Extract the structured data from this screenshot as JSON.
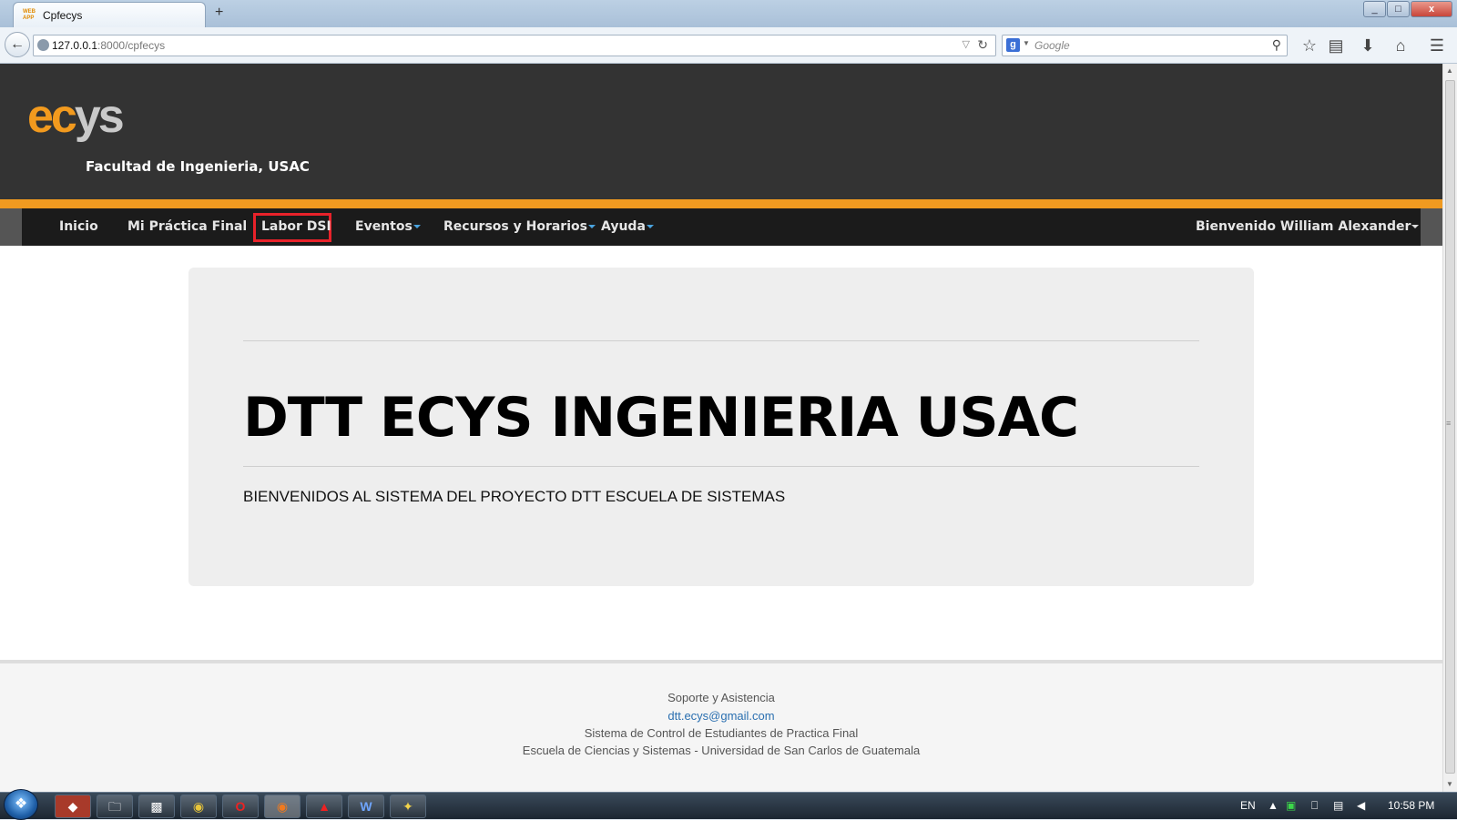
{
  "browser": {
    "tab_title": "Cpfecys",
    "favicon_text": "WEB APP",
    "new_tab": "+",
    "url_host": "127.0.0.1",
    "url_path": ":8000/cpfecys",
    "search_placeholder": "Google",
    "window_controls": {
      "minimize": "_",
      "maximize": "□",
      "close": "x"
    }
  },
  "site": {
    "logo_part1": "ec",
    "logo_part2": "ys",
    "faculty": "Facultad de Ingenieria, USAC",
    "menu": {
      "inicio": "Inicio",
      "practica": "Mi Práctica Final",
      "labor": "Labor DSI",
      "eventos": "Eventos",
      "recursos": "Recursos y Horarios",
      "ayuda": "Ayuda",
      "user": "Bienvenido William Alexander"
    },
    "hero": {
      "title": "DTT ECYS INGENIERIA USAC",
      "subtitle": "BIENVENIDOS AL SISTEMA DEL PROYECTO DTT ESCUELA DE SISTEMAS"
    },
    "footer": {
      "support": "Soporte y Asistencia",
      "email": "dtt.ecys@gmail.com",
      "system": "Sistema de Control de Estudiantes de Practica Final",
      "school": "Escuela de Ciencias y Sistemas - Universidad de San Carlos de Guatemala"
    }
  },
  "taskbar": {
    "language": "EN",
    "clock": "10:58 PM"
  },
  "colors": {
    "header_bg": "#333333",
    "accent_orange": "#f09a20",
    "menu_bg": "#1b1b1b",
    "highlight_red": "#e8222a"
  }
}
